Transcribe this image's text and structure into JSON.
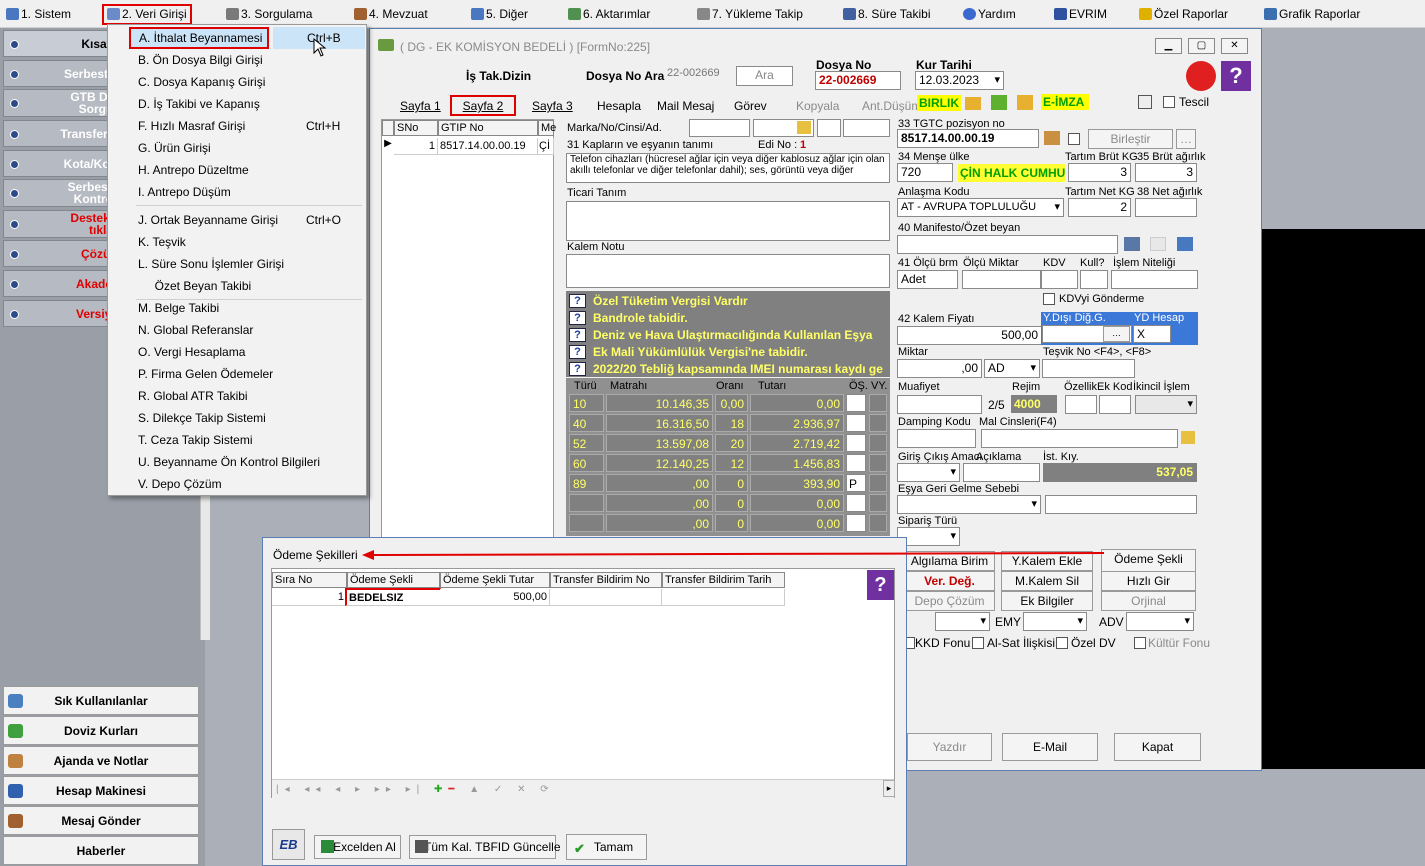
{
  "menu": [
    {
      "label": "1.  Sistem"
    },
    {
      "label": "2.  Veri Girişi"
    },
    {
      "label": "3.  Sorgulama"
    },
    {
      "label": "4.  Mevzuat"
    },
    {
      "label": "5.  Diğer"
    },
    {
      "label": "6.  Aktarımlar"
    },
    {
      "label": "7.  Yükleme Takip"
    },
    {
      "label": "8. Süre Takibi"
    },
    {
      "label": "Yardım"
    },
    {
      "label": "EVRIM"
    },
    {
      "label": "Özel Raporlar"
    },
    {
      "label": "Grafik Raporlar"
    }
  ],
  "dropdown": [
    {
      "label": "A.  İthalat Beyannamesi",
      "shortcut": "Ctrl+B"
    },
    {
      "label": "B.  Ön Dosya Bilgi Girişi",
      "shortcut": ""
    },
    {
      "label": "C.  Dosya Kapanış Girişi",
      "shortcut": ""
    },
    {
      "label": "D.  İş Takibi ve Kapanış",
      "shortcut": ""
    },
    {
      "label": "F.  Hızlı Masraf Girişi",
      "shortcut": "Ctrl+H"
    },
    {
      "label": "G.  Ürün Girişi",
      "shortcut": ""
    },
    {
      "label": "H.  Antrepo Düzeltme",
      "shortcut": ""
    },
    {
      "label": "I.   Antrepo Düşüm",
      "shortcut": ""
    },
    {
      "label": "J.   Ortak Beyanname Girişi",
      "shortcut": "Ctrl+O"
    },
    {
      "label": "K.  Teşvik",
      "shortcut": ""
    },
    {
      "label": "L.   Süre Sonu İşlemler Girişi",
      "shortcut": ""
    },
    {
      "label": "     Özet Beyan Takibi",
      "shortcut": ""
    },
    {
      "label": "M.   Belge Takibi",
      "shortcut": ""
    },
    {
      "label": "N.  Global Referanslar",
      "shortcut": ""
    },
    {
      "label": "O. Vergi Hesaplama",
      "shortcut": ""
    },
    {
      "label": "P. Firma Gelen Ödemeler",
      "shortcut": ""
    },
    {
      "label": "R. Global ATR Takibi",
      "shortcut": ""
    },
    {
      "label": "S. Dilekçe Takip Sistemi",
      "shortcut": ""
    },
    {
      "label": "T. Ceza Takip Sistemi",
      "shortcut": ""
    },
    {
      "label": "U. Beyanname Ön Kontrol Bilgileri",
      "shortcut": ""
    },
    {
      "label": "V. Depo Çözüm",
      "shortcut": ""
    }
  ],
  "left_panel": {
    "items": [
      {
        "label": "Kısayo"
      },
      {
        "label": "Serbest Bölg"
      },
      {
        "label": "GTB DIR B\nSorgula"
      },
      {
        "label": "Transfer Bildir"
      },
      {
        "label": "Kota/Kontenj"
      },
      {
        "label": "Serbest Böl\nKontrol U"
      },
      {
        "label": "Destek Vid\ntıkla"
      },
      {
        "label": "Çözüm"
      },
      {
        "label": "Akademi"
      },
      {
        "label": "Versiyon"
      }
    ],
    "bottom": [
      {
        "label": "Sık Kullanılanlar"
      },
      {
        "label": "Doviz Kurları"
      },
      {
        "label": "Ajanda ve Notlar"
      },
      {
        "label": "Hesap Makinesi"
      },
      {
        "label": "Mesaj Gönder"
      },
      {
        "label": "Haberler"
      }
    ]
  },
  "main": {
    "title": "( DG  - EK KOMİSYON BEDELİ ) [FormNo:225]",
    "is_tak": "İş Tak.Dizin",
    "dosya_no_ara_label": "Dosya No Ara",
    "dosya_no_ara_value": "22-002669",
    "ara_btn": "Ara",
    "dosya_no_label": "Dosya No",
    "dosya_no_value": "22-002669",
    "kur_tarihi_label": "Kur Tarihi",
    "kur_tarihi_value": "12.03.2023",
    "tabs": [
      "Sayfa 1",
      "Sayfa 2",
      "Sayfa 3",
      "Hesapla",
      "Mail Mesaj",
      "Görev",
      "Kopyala",
      "Ant.Düşüm"
    ],
    "birlik": "BIRLIK",
    "eimza": "E-İMZA",
    "tescil": "Tescil",
    "grid_cols": [
      "SNo",
      "GTIP No",
      "Me"
    ],
    "grid_row": {
      "sno": "1",
      "gtip": "8517.14.00.00.19",
      "me": "Çİ"
    },
    "marka_label": "Marka/No/Cinsi/Ad.",
    "kaplar_label": "31 Kapların ve eşyanın tanımı",
    "edi_label": "Edi No :",
    "edi_value": "1",
    "tanim_text": "Telefon cihazları (hücresel ağlar için veya diğer kablosuz ağlar için olan akıllı telefonlar ve diğer telefonlar dahil); ses, görüntü veya diğer",
    "ticari_label": "Ticari Tanım",
    "kalem_notu_label": "Kalem Notu",
    "warnings": [
      "Özel Tüketim Vergisi Vardır",
      "Bandrole tabidir.",
      "Deniz ve Hava Ulaştırmacılığında Kullanılan Eşya",
      "Ek Mali Yükümlülük Vergisi'ne tabidir.",
      "2022/20 Tebliğ kapsamında IMEI numarası kaydı ge"
    ],
    "tax_headers": [
      "Türü",
      "Matrahı",
      "Oranı",
      "Tutarı",
      "ÖŞ.",
      "VY."
    ],
    "tax_rows": [
      {
        "turu": "10",
        "matrah": "10.146,35",
        "oran": "0,00",
        "tutar": "0,00",
        "os": ""
      },
      {
        "turu": "40",
        "matrah": "16.316,50",
        "oran": "18",
        "tutar": "2.936,97",
        "os": ""
      },
      {
        "turu": "52",
        "matrah": "13.597,08",
        "oran": "20",
        "tutar": "2.719,42",
        "os": ""
      },
      {
        "turu": "60",
        "matrah": "12.140,25",
        "oran": "12",
        "tutar": "1.456,83",
        "os": ""
      },
      {
        "turu": "89",
        "matrah": ",00",
        "oran": "0",
        "tutar": "393,90",
        "os": "P"
      },
      {
        "turu": "",
        "matrah": ",00",
        "oran": "0",
        "tutar": "0,00",
        "os": ""
      },
      {
        "turu": "",
        "matrah": ",00",
        "oran": "0",
        "tutar": "0,00",
        "os": ""
      }
    ],
    "right": {
      "tgtc_label": "33 TGTC pozisyon no",
      "tgtc_value": "8517.14.00.00.19",
      "birlestir": "Birleştir",
      "mense_label": "34 Menşe ülke",
      "mense_code": "720",
      "mense_name": "ÇİN HALK CUMHU",
      "tartim_brut_label": "Tartım Brüt KG",
      "tartim_brut_value": "3",
      "brut_agirlik_label": "35 Brüt ağırlık",
      "brut_agirlik_value": "3",
      "anlasma_label": "Anlaşma Kodu",
      "anlasma_value": "AT    - AVRUPA TOPLULUĞU",
      "tartim_net_label": "Tartım Net KG",
      "tartim_net_value": "2",
      "net_agirlik_label": "38 Net ağırlık",
      "manifesto_label": "40 Manifesto/Özet beyan",
      "olcu_brm_label": "41 Ölçü brm",
      "olcu_brm_value": "Adet",
      "olcu_miktar_label": "Ölçü Miktar",
      "kdv_label": "KDV",
      "kull_label": "Kull?",
      "islem_niteligi_label": "İşlem Niteliği",
      "kdv_gonderme": "KDVyi Gönderme",
      "kalem_fiyati_label": "42 Kalem Fiyatı",
      "kalem_fiyati_value": "500,00",
      "ydisi_label": "Y.Dışı Diğ.G.",
      "yd_hesap_label": "YD Hesap",
      "yd_hesap_value": "X",
      "miktar_label": "Miktar",
      "miktar_value": ",00",
      "miktar_unit": "AD",
      "tesvik_label": "Teşvik No <F4>, <F8>",
      "muafiyet_label": "Muafiyet",
      "muafiyet_value": "2/5",
      "rejim_label": "Rejim",
      "rejim_value": "4000",
      "ozellik_label": "Özellik",
      "ek_kod_label": "Ek Kod",
      "ikincil_label": "İkincil İşlem",
      "damping_label": "Damping Kodu",
      "mal_cinsleri_label": "Mal Cinsleri(F4)",
      "giris_cikis_label": "Giriş Çıkış Amacı",
      "aciklama_label": "Açıklama",
      "ist_kiy_label": "İst. Kıy.",
      "ist_kiy_value": "537,05",
      "esya_geri_label": "Eşya Geri Gelme Sebebi",
      "siparis_label": "Sipariş Türü"
    },
    "buttons": {
      "algilama": "Algılama Birim",
      "y_kalem": "Y.Kalem Ekle",
      "odeme_sekli": "Ödeme Şekli",
      "ver_deg": "Ver. Değ.",
      "m_kalem_sil": "M.Kalem Sil",
      "hizli_gir": "Hızlı Gir",
      "depo_cozum": "Depo Çözüm",
      "ek_bilgiler": "Ek Bilgiler",
      "orijinal": "Orjinal",
      "emy": "EMY",
      "adv": "ADV",
      "kkd": "KKD Fonu",
      "alsat": "Al-Sat İlişkisi",
      "ozel_dv": "Özel DV",
      "kultur": "Kültür Fonu",
      "yazdir": "Yazdır",
      "email": "E-Mail",
      "kapat": "Kapat"
    }
  },
  "odeme": {
    "title": "Ödeme Şekilleri",
    "headers": [
      "Sıra No",
      "Ödeme Şekli",
      "Ödeme Şekli Tutar",
      "Transfer Bildirim No",
      "Transfer Bildirim Tarih"
    ],
    "row": {
      "sira": "1",
      "sekli": "BEDELSIZ",
      "tutar": "500,00",
      "tno": "",
      "ttarih": ""
    },
    "buttons": [
      "Excelden Al",
      "Tüm Kal. TBFID Güncelle",
      "Tamam"
    ]
  },
  "colors": {
    "accent_red": "#e00000",
    "gray_panel": "#808080",
    "warn_yellow": "#ffff66",
    "birlik_green": "#00c000"
  }
}
